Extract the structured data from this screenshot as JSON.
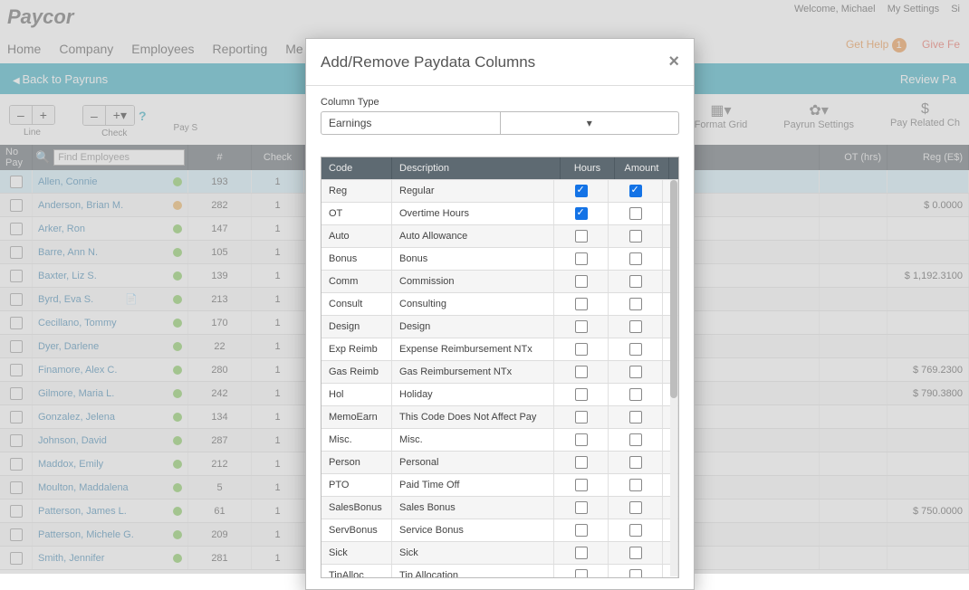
{
  "topbar": {
    "welcome": "Welcome, Michael",
    "settings": "My Settings",
    "signout": "Si"
  },
  "logo": "Paycor",
  "nav": {
    "home": "Home",
    "company": "Company",
    "employees": "Employees",
    "reporting": "Reporting",
    "me": "Me"
  },
  "help": {
    "gethelp": "Get Help",
    "badge": "1",
    "givefeedback": "Give Fe"
  },
  "bluebar": {
    "back": "Back to Payruns",
    "review": "Review Pa"
  },
  "toolbar": {
    "line": "Line",
    "check": "Check",
    "paystub": "Pay S",
    "minus": "–",
    "plus": "+",
    "plusdown": "+▾",
    "format": "Format Grid",
    "payrun": "Payrun Settings",
    "payrelated": "Pay Related Ch"
  },
  "gridheader": {
    "nopay": "No Pay",
    "search_placeholder": "Find Employees",
    "num": "#",
    "check": "Check",
    "ot": "OT  (hrs)",
    "reg": "Reg  (E$)"
  },
  "employees": [
    {
      "name": "Allen, Connie",
      "num": "193",
      "check": "1",
      "dot": "green",
      "reg": "",
      "selected": true
    },
    {
      "name": "Anderson, Brian M.",
      "num": "282",
      "check": "1",
      "dot": "orange",
      "reg": "$ 0.0000"
    },
    {
      "name": "Arker, Ron",
      "num": "147",
      "check": "1",
      "dot": "green",
      "reg": ""
    },
    {
      "name": "Barre, Ann N.",
      "num": "105",
      "check": "1",
      "dot": "green",
      "reg": ""
    },
    {
      "name": "Baxter, Liz S.",
      "num": "139",
      "check": "1",
      "dot": "green",
      "reg": "$ 1,192.3100"
    },
    {
      "name": "Byrd, Eva S.",
      "num": "213",
      "check": "1",
      "dot": "green",
      "reg": "",
      "note": true
    },
    {
      "name": "Cecillano, Tommy",
      "num": "170",
      "check": "1",
      "dot": "green",
      "reg": ""
    },
    {
      "name": "Dyer, Darlene",
      "num": "22",
      "check": "1",
      "dot": "green",
      "reg": ""
    },
    {
      "name": "Finamore, Alex C.",
      "num": "280",
      "check": "1",
      "dot": "green",
      "reg": "$ 769.2300"
    },
    {
      "name": "Gilmore, Maria L.",
      "num": "242",
      "check": "1",
      "dot": "green",
      "reg": "$ 790.3800"
    },
    {
      "name": "Gonzalez, Jelena",
      "num": "134",
      "check": "1",
      "dot": "green",
      "reg": ""
    },
    {
      "name": "Johnson, David",
      "num": "287",
      "check": "1",
      "dot": "green",
      "reg": ""
    },
    {
      "name": "Maddox, Emily",
      "num": "212",
      "check": "1",
      "dot": "green",
      "reg": ""
    },
    {
      "name": "Moulton, Maddalena",
      "num": "5",
      "check": "1",
      "dot": "green",
      "reg": ""
    },
    {
      "name": "Patterson, James L.",
      "num": "61",
      "check": "1",
      "dot": "green",
      "reg": "$ 750.0000"
    },
    {
      "name": "Patterson, Michele G.",
      "num": "209",
      "check": "1",
      "dot": "green",
      "reg": ""
    },
    {
      "name": "Smith, Jennifer",
      "num": "281",
      "check": "1",
      "dot": "green",
      "reg": ""
    }
  ],
  "modal": {
    "title": "Add/Remove Paydata Columns",
    "column_type_label": "Column Type",
    "column_type_value": "Earnings",
    "headers": {
      "code": "Code",
      "desc": "Description",
      "hours": "Hours",
      "amount": "Amount"
    },
    "rows": [
      {
        "code": "Reg",
        "desc": "Regular",
        "hours": true,
        "amount": true
      },
      {
        "code": "OT",
        "desc": "Overtime Hours",
        "hours": true,
        "amount": false
      },
      {
        "code": "Auto",
        "desc": "Auto Allowance",
        "hours": false,
        "amount": false
      },
      {
        "code": "Bonus",
        "desc": "Bonus",
        "hours": false,
        "amount": false
      },
      {
        "code": "Comm",
        "desc": "Commission",
        "hours": false,
        "amount": false
      },
      {
        "code": "Consult",
        "desc": "Consulting",
        "hours": false,
        "amount": false
      },
      {
        "code": "Design",
        "desc": "Design",
        "hours": false,
        "amount": false
      },
      {
        "code": "Exp Reimb",
        "desc": "Expense Reimbursement NTx",
        "hours": false,
        "amount": false
      },
      {
        "code": "Gas Reimb",
        "desc": "Gas Reimbursement NTx",
        "hours": false,
        "amount": false
      },
      {
        "code": "Hol",
        "desc": "Holiday",
        "hours": false,
        "amount": false
      },
      {
        "code": "MemoEarn",
        "desc": "This Code Does Not Affect Pay",
        "hours": false,
        "amount": false
      },
      {
        "code": "Misc.",
        "desc": "Misc.",
        "hours": false,
        "amount": false
      },
      {
        "code": "Person",
        "desc": "Personal",
        "hours": false,
        "amount": false
      },
      {
        "code": "PTO",
        "desc": "Paid Time Off",
        "hours": false,
        "amount": false
      },
      {
        "code": "SalesBonus",
        "desc": "Sales Bonus",
        "hours": false,
        "amount": false
      },
      {
        "code": "ServBonus",
        "desc": "Service Bonus",
        "hours": false,
        "amount": false
      },
      {
        "code": "Sick",
        "desc": "Sick",
        "hours": false,
        "amount": false
      },
      {
        "code": "TipAlloc",
        "desc": "Tip Allocation",
        "hours": false,
        "amount": false
      }
    ]
  }
}
